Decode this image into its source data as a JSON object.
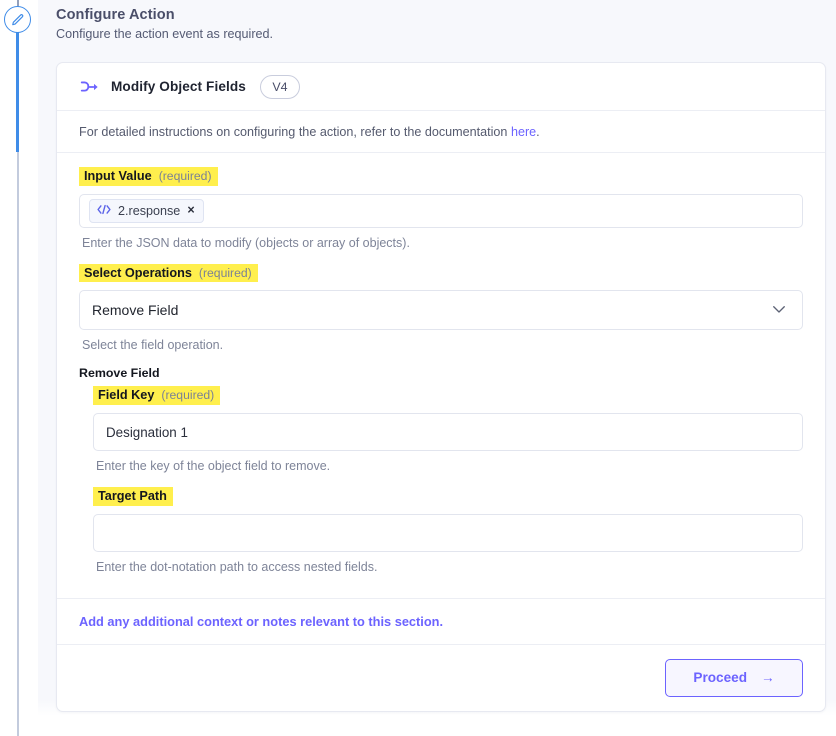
{
  "page": {
    "title": "Configure Action",
    "subtitle": "Configure the action event as required.",
    "rail_icon": "pencil-icon"
  },
  "card": {
    "icon": "node-branch-icon",
    "title": "Modify Object Fields",
    "version_badge": "V4",
    "doc_note": {
      "text_before": "For detailed instructions on configuring the action, refer to the documentation ",
      "link_text": "here",
      "text_after": "."
    },
    "fields": {
      "input_value": {
        "label": "Input Value",
        "required_text": "(required)",
        "token": {
          "icon": "code-brackets-icon",
          "text": "2.response",
          "remove": "×"
        },
        "hint": "Enter the JSON data to modify (objects or array of objects)."
      },
      "select_operations": {
        "label": "Select Operations",
        "required_text": "(required)",
        "value": "Remove Field",
        "chevron": "chevron-down-icon",
        "hint": "Select the field operation."
      },
      "section_heading": "Remove Field",
      "field_key": {
        "label": "Field Key",
        "required_text": "(required)",
        "value": "Designation 1",
        "placeholder": "",
        "hint": "Enter the key of the object field to remove."
      },
      "target_path": {
        "label": "Target Path",
        "required_text": "",
        "value": "",
        "placeholder": "",
        "hint": "Enter the dot-notation path to access nested fields."
      }
    },
    "notes_link": "Add any additional context or notes relevant to this section.",
    "proceed_button": {
      "label": "Proceed",
      "arrow": "→"
    }
  },
  "colors": {
    "accent_purple": "#6c63ff",
    "rail_blue": "#3f8ce8",
    "highlight_yellow": "#ffef4d",
    "page_bg": "#f7f8fc"
  }
}
